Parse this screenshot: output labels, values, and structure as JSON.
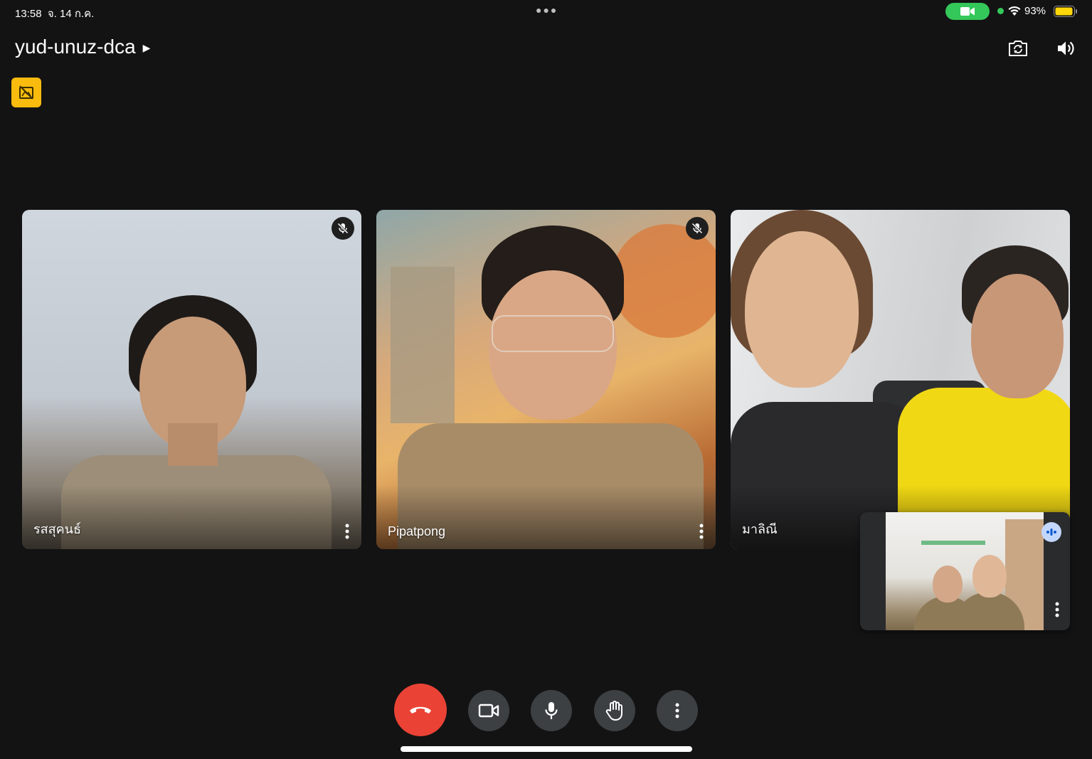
{
  "status_bar": {
    "time": "13:58",
    "date": "จ. 14 ก.ค.",
    "battery": "93%",
    "indicator_colors": {
      "camera_pill": "#34c759",
      "battery": "#ffd60a"
    }
  },
  "header": {
    "meeting_code": "yud-unuz-dca",
    "icons": [
      "switch-camera-icon",
      "speaker-icon"
    ],
    "badge_icon": "no-background-icon",
    "badge_color": "#f9bb0e"
  },
  "participants": [
    {
      "name": "รสสุคนธ์",
      "muted": true
    },
    {
      "name": "Pipatpong",
      "muted": true
    },
    {
      "name": "มาลิณี",
      "muted": false
    }
  ],
  "self_view": {
    "speaking": true
  },
  "controls": [
    {
      "name": "end-call",
      "icon": "hang-up-icon",
      "color": "#ea4335"
    },
    {
      "name": "camera",
      "icon": "video-camera-icon",
      "color": "#3c4043"
    },
    {
      "name": "microphone",
      "icon": "microphone-icon",
      "color": "#3c4043"
    },
    {
      "name": "raise-hand",
      "icon": "hand-icon",
      "color": "#3c4043"
    },
    {
      "name": "more-options",
      "icon": "more-vertical-icon",
      "color": "#3c4043"
    }
  ]
}
